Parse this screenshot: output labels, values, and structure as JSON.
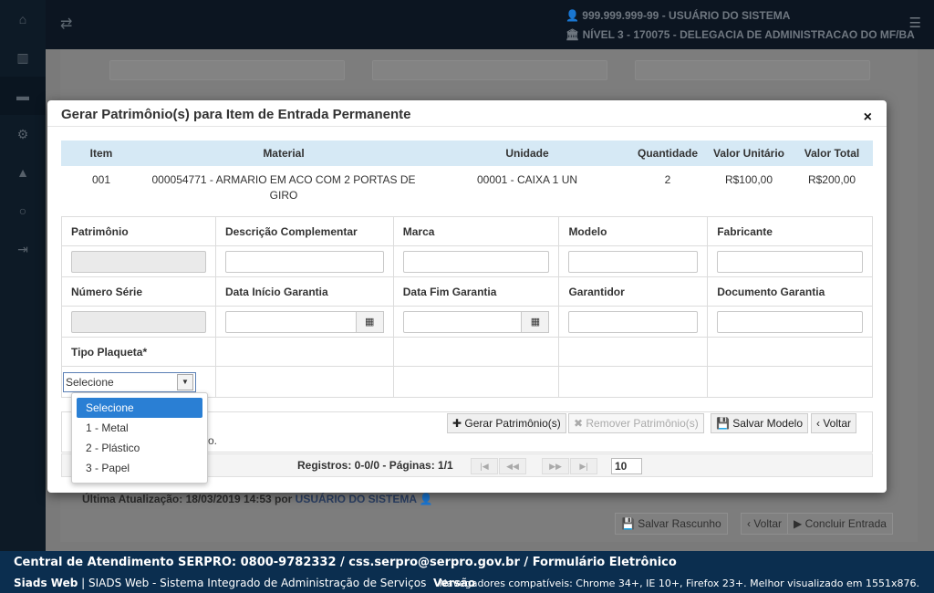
{
  "header": {
    "user_line": "999.999.999-99 - USUÁRIO DO SISTEMA",
    "unit_line": "NÍVEL 3 - 170075 - DELEGACIA DE ADMINISTRACAO DO MF/BA"
  },
  "background": {
    "last_update_prefix": "Última Atualização: 18/03/2019 14:53 por",
    "last_update_user": "USUÁRIO DO SISTEMA",
    "buttons": [
      "Salvar Rascunho",
      "Voltar",
      "Concluir Entrada"
    ]
  },
  "modal": {
    "title": "Gerar Patrimônio(s) para Item de Entrada Permanente",
    "close_label": "×",
    "item_table": {
      "headers": [
        "Item",
        "Material",
        "Unidade",
        "Quantidade",
        "Valor Unitário",
        "Valor Total"
      ],
      "row": [
        "001",
        "000054771 - ARMARIO EM ACO COM 2 PORTAS DE GIRO",
        "00001 - CAIXA 1 UN",
        "2",
        "R$100,00",
        "R$200,00"
      ]
    },
    "form": {
      "row1_labels": [
        "Patrimônio",
        "Descrição Complementar",
        "Marca",
        "Modelo",
        "Fabricante"
      ],
      "row2_labels": [
        "Número Série",
        "Data Início Garantia",
        "Data Fim Garantia",
        "Garantidor",
        "Documento Garantia"
      ],
      "tipo_plaqueta_label": "Tipo Plaqueta*",
      "tipo_plaqueta_value": "Selecione"
    },
    "actions": {
      "gerar": "Gerar Patrimônio(s)",
      "remover": "Remover Patrimônio(s)",
      "salvar_modelo": "Salvar Modelo",
      "voltar": "Voltar"
    },
    "partial_text": "o.",
    "pager": {
      "text": "Registros: 0-0/0 - Páginas: 1/1",
      "page_size": "10"
    },
    "dropdown_options": [
      "Selecione",
      "1 - Metal",
      "2 - Plástico",
      "3 - Papel"
    ]
  },
  "footer": {
    "line1": "Central de Atendimento SERPRO: 0800-9782332 / css.serpro@serpro.gov.br / Formulário Eletrônico",
    "brand": "Siads Web",
    "system": "| SIADS Web - Sistema Integrado de Administração de Serviços",
    "version": "Versão",
    "compat": "Navegadores compatíveis: Chrome 34+, IE 10+, Firefox 23+. Melhor visualizado em 1551x876."
  },
  "colors": {
    "footer_bg": "#0b2e4f",
    "table_header_bg": "#d6e9f5",
    "dropdown_selected": "#2a7fd4"
  }
}
